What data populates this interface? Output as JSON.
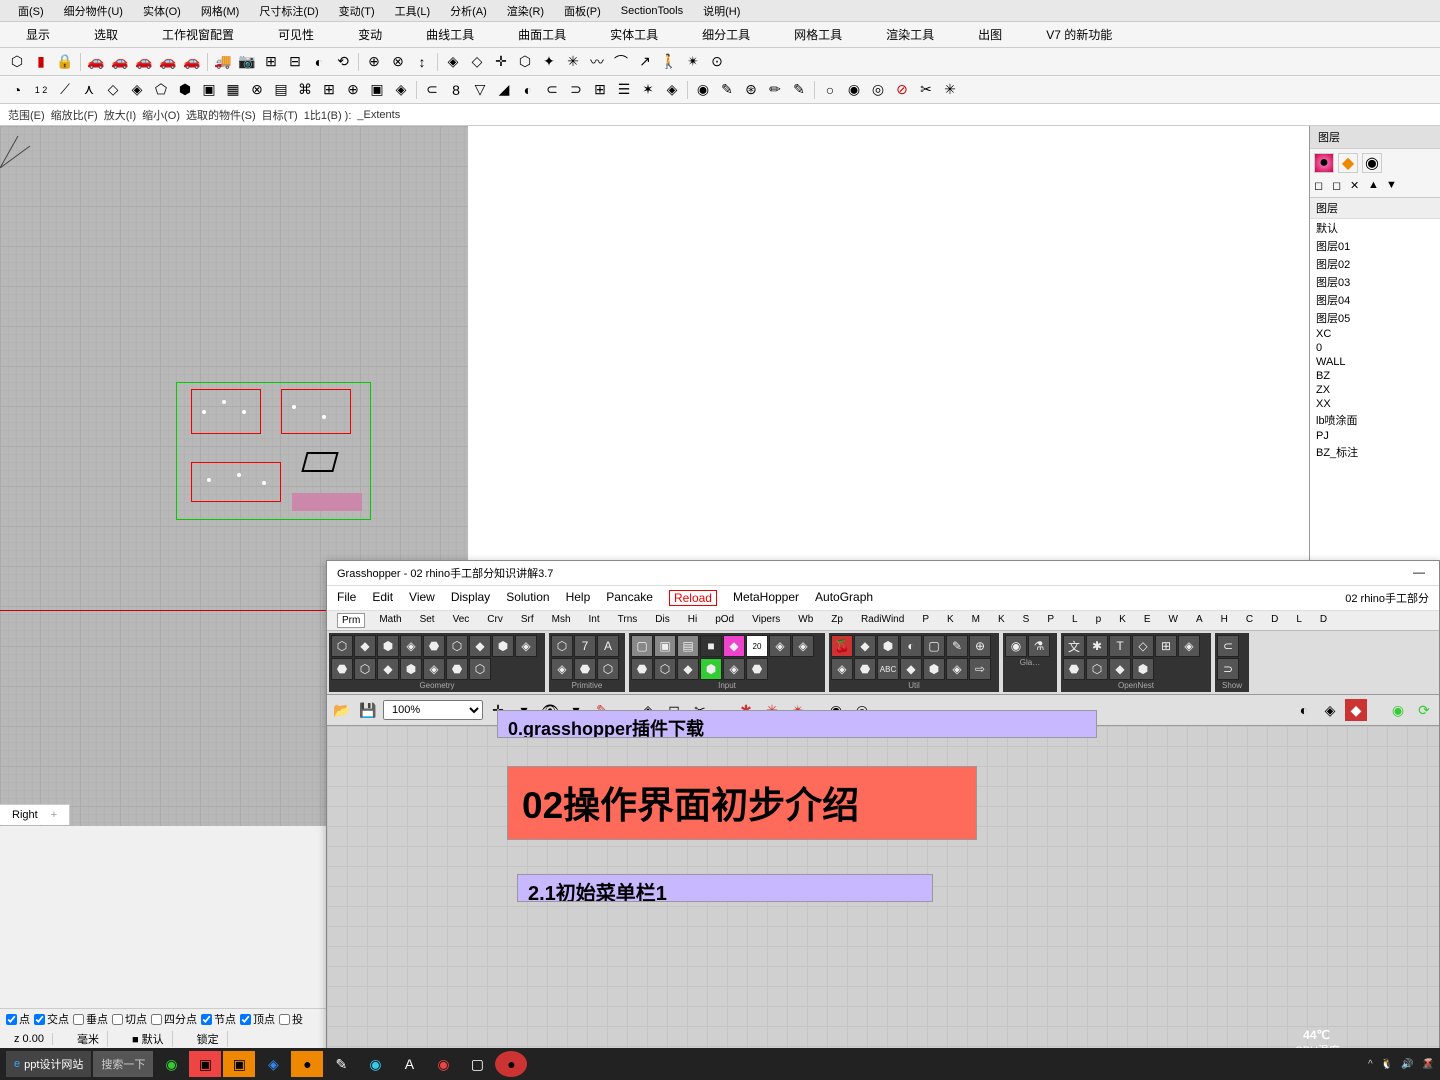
{
  "menu": [
    "面(S)",
    "细分物件(U)",
    "实体(O)",
    "网格(M)",
    "尺寸标注(D)",
    "变动(T)",
    "工具(L)",
    "分析(A)",
    "渲染(R)",
    "面板(P)",
    "SectionTools",
    "说明(H)"
  ],
  "tabs": [
    "显示",
    "选取",
    "工作视窗配置",
    "可见性",
    "变动",
    "曲线工具",
    "曲面工具",
    "实体工具",
    "细分工具",
    "网格工具",
    "渲染工具",
    "出图",
    "V7 的新功能"
  ],
  "command": {
    "parts": [
      "范围(E)",
      "缩放比(F)",
      "放大(I)",
      "缩小(O)",
      "选取的物件(S)",
      "目标(T)",
      "1比1(B) ):",
      "_Extents"
    ]
  },
  "side_panel": {
    "title": "图层",
    "layer_header": "图层",
    "layers": [
      "默认",
      "图层01",
      "图层02",
      "图层03",
      "图层04",
      "图层05",
      "XC",
      "0",
      "WALL",
      "BZ",
      "ZX",
      "XX",
      "lb喷涂面",
      "PJ",
      "BZ_标注"
    ]
  },
  "viewport": {
    "label": "Right",
    "plus": "+"
  },
  "osnap": {
    "items": [
      {
        "label": "点",
        "checked": true
      },
      {
        "label": "交点",
        "checked": true
      },
      {
        "label": "垂点",
        "checked": false
      },
      {
        "label": "切点",
        "checked": false
      },
      {
        "label": "四分点",
        "checked": false
      },
      {
        "label": "节点",
        "checked": true
      },
      {
        "label": "顶点",
        "checked": true
      },
      {
        "label": "投",
        "checked": false
      }
    ]
  },
  "status": {
    "z": "z 0.00",
    "unit": "毫米",
    "default": "默认",
    "lock": "锁定"
  },
  "gh": {
    "title": "Grasshopper - 02 rhino手工部分知识讲解3.7",
    "doc_name": "02 rhino手工部分",
    "menu": [
      "File",
      "Edit",
      "View",
      "Display",
      "Solution",
      "Help",
      "Pancake"
    ],
    "reload": "Reload",
    "menu2": [
      "MetaHopper",
      "AutoGraph"
    ],
    "tabs": [
      "Prm",
      "Math",
      "Set",
      "Vec",
      "Crv",
      "Srf",
      "Msh",
      "Int",
      "Trns",
      "Dis",
      "Hi",
      "pOd",
      "Vipers",
      "Wb",
      "Zp",
      "RadiWind",
      "P",
      "K",
      "M",
      "K",
      "S",
      "P",
      "L",
      "p",
      "K",
      "E",
      "W",
      "A",
      "H",
      "C",
      "D",
      "L",
      "D"
    ],
    "groups": [
      "Geometry",
      "Primitive",
      "Input",
      "Util",
      "Gla…",
      "OpenNest",
      "Show"
    ],
    "zoom": "100%",
    "canvas": {
      "panel1": "0.grasshopper插件下载",
      "panel2": "02操作界面初步介绍",
      "panel3": "2.1初始菜单栏1"
    }
  },
  "taskbar": {
    "site": "ppt设计网站",
    "search": "搜索一下"
  },
  "overlay": {
    "temp": "44℃",
    "cpu": "CPU温度"
  }
}
